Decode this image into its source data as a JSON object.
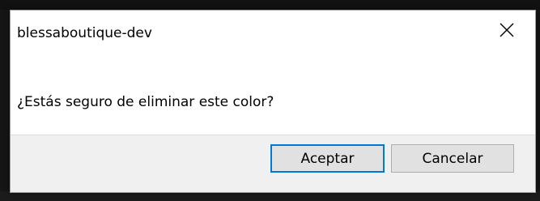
{
  "dialog": {
    "title": "blessaboutique-dev",
    "message": "¿Estás seguro de eliminar este color?",
    "close_icon": "close-icon",
    "buttons": {
      "ok_label": "Aceptar",
      "cancel_label": "Cancelar"
    }
  },
  "colors": {
    "focus_border": "#0078d7",
    "button_bg": "#e1e1e1",
    "footer_bg": "#f0f0f0"
  }
}
